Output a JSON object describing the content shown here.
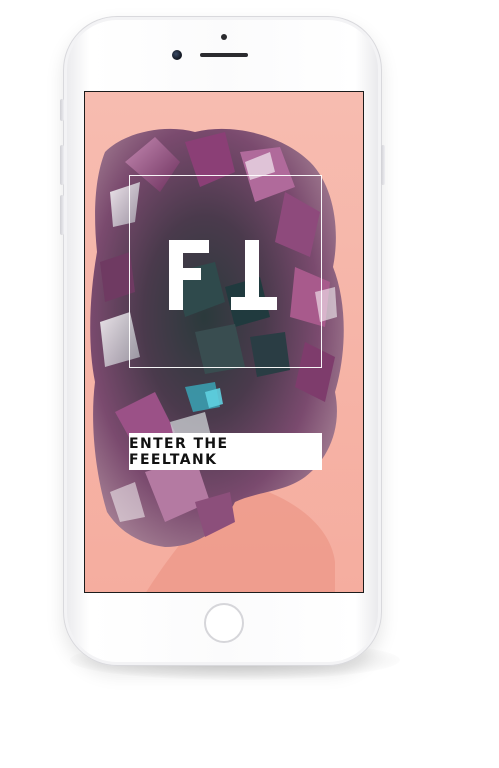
{
  "device": {
    "type": "phone",
    "color": "#ffffff"
  },
  "screen": {
    "background_color": "#f6b3a6",
    "logo": {
      "text": "F1",
      "color": "#ffffff"
    },
    "enter_button": {
      "label": "ENTER THE FEELTANK"
    }
  }
}
